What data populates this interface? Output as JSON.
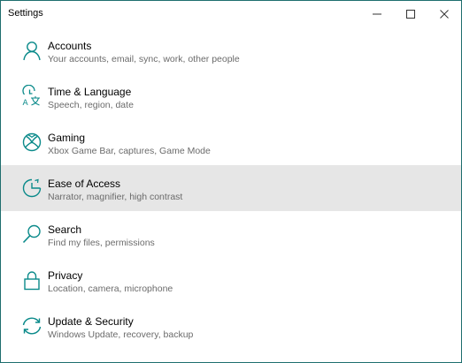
{
  "window": {
    "title": "Settings",
    "controls": {
      "minimize": "—",
      "maximize": "☐",
      "close": "✕"
    }
  },
  "items": [
    {
      "title": "Accounts",
      "subtitle": "Your accounts, email, sync, work, other people",
      "icon": "person-icon",
      "selected": false
    },
    {
      "title": "Time & Language",
      "subtitle": "Speech, region, date",
      "icon": "time-language-icon",
      "selected": false
    },
    {
      "title": "Gaming",
      "subtitle": "Xbox Game Bar, captures, Game Mode",
      "icon": "xbox-icon",
      "selected": false
    },
    {
      "title": "Ease of Access",
      "subtitle": "Narrator, magnifier, high contrast",
      "icon": "ease-of-access-icon",
      "selected": true
    },
    {
      "title": "Search",
      "subtitle": "Find my files, permissions",
      "icon": "search-icon",
      "selected": false
    },
    {
      "title": "Privacy",
      "subtitle": "Location, camera, microphone",
      "icon": "lock-icon",
      "selected": false
    },
    {
      "title": "Update & Security",
      "subtitle": "Windows Update, recovery, backup",
      "icon": "sync-icon",
      "selected": false
    }
  ],
  "colors": {
    "accent": "#0a8a8a",
    "border": "#1f6e6e",
    "selected_bg": "#e6e6e6"
  }
}
